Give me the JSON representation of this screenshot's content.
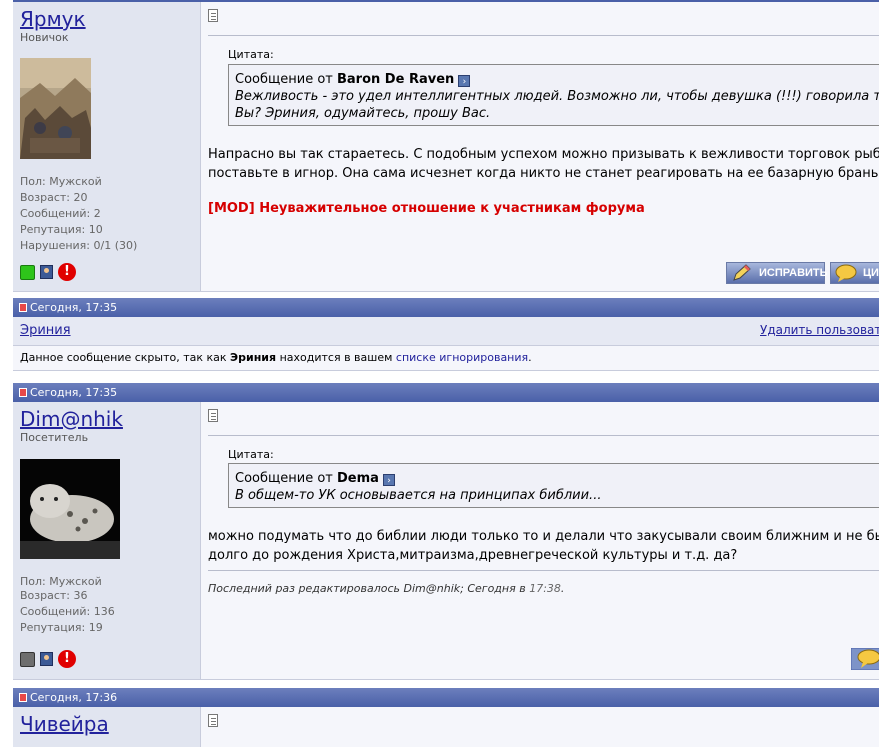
{
  "post1": {
    "username": "Ярмук",
    "user_title": "Новичок",
    "info": [
      "Пол: Мужской",
      "Возраст: 20",
      "Сообщений: 2",
      "Репутация: 10",
      "Нарушения: 0/1 (30)"
    ],
    "quote_label": "Цитата:",
    "quote_prefix": "Сообщение от",
    "quote_author": "Baron De Raven",
    "quote_line1": "Вежливость - это удел интеллигентных людей. Возможно ли, чтобы девушка (!!!) говорила т",
    "quote_line2": "Вы? Эриния, одумайтесь, прошу Вас.",
    "text_line1": "Напрасно вы так стараетесь. С подобным успехом можно призывать к вежливости торговок рыбо",
    "text_line2": "поставьте в игнор. Она сама исчезнет когда никто не станет реагировать на ее базарную брань",
    "mod_note": "[MOD] Неуважительное отношение к участникам форума",
    "edit_button": "ИСПРАВИТЬ",
    "quote_button": "ЦИ"
  },
  "ignored_post": {
    "date": "Сегодня, 17:35",
    "username": "Эриния",
    "remove_link": "Удалить пользовате",
    "msg_before": "Данное сообщение скрыто, так как",
    "msg_name": "Эриния",
    "msg_middle": "находится в вашем",
    "msg_link": "списке игнорирования",
    "msg_end": "."
  },
  "post2": {
    "date": "Сегодня, 17:35",
    "username": "Dim@nhik",
    "user_title": "Посетитель",
    "info": [
      "Пол: Мужской",
      "Возраст: 36",
      "Сообщений: 136",
      "Репутация: 19"
    ],
    "quote_label": "Цитата:",
    "quote_prefix": "Сообщение от",
    "quote_author": "Dema",
    "quote_line1": "В общем-то УК основывается на принципах библии...",
    "text_line1": "можно подумать что до библии люди только то и делали что закусывали своим ближним и не бы",
    "text_line2": "долго до рождения Христа,митраизма,древнегреческой культуры и т.д. да?",
    "edited_prefix": "Последний раз редактировалось Dim@nhik; Сегодня в",
    "edited_time": "17:38",
    "edited_end": "."
  },
  "post3": {
    "date": "Сегодня, 17:36",
    "username": "Чивейра"
  },
  "colors": {
    "header_bar": "#4a60a8",
    "user_column": "#e1e5f0",
    "mod_note": "#d60000",
    "link": "#22229c"
  }
}
